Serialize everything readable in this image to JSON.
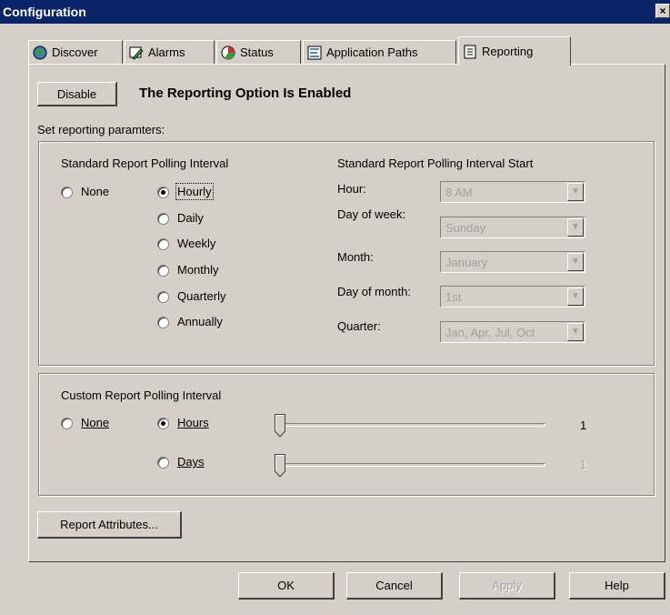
{
  "window": {
    "title": "Configuration",
    "close_glyph": "×"
  },
  "tabs": [
    {
      "label": "Discover",
      "icon": "globe-icon",
      "active": false
    },
    {
      "label": "Alarms",
      "icon": "alarm-icon",
      "active": false
    },
    {
      "label": "Status",
      "icon": "status-icon",
      "active": false
    },
    {
      "label": "Application Paths",
      "icon": "application-paths-icon",
      "active": false
    },
    {
      "label": "Reporting",
      "icon": "reporting-icon",
      "active": true
    }
  ],
  "reporting": {
    "disable_button": "Disable",
    "status_text": "The Reporting Option Is Enabled",
    "set_params_label": "Set reporting paramters:",
    "standard": {
      "title": "Standard Report Polling Interval",
      "none_label": "None",
      "options": [
        "Hourly",
        "Daily",
        "Weekly",
        "Monthly",
        "Quarterly",
        "Annually"
      ],
      "selected": "Hourly"
    },
    "start": {
      "title": "Standard Report Polling Interval Start",
      "fields": [
        {
          "label": "Hour:",
          "value": "8 AM"
        },
        {
          "label": "Day of week:",
          "value": "Sunday"
        },
        {
          "label": "Month:",
          "value": "January"
        },
        {
          "label": "Day of month:",
          "value": "1st"
        },
        {
          "label": "Quarter:",
          "value": "Jan, Apr, Jul, Oct"
        }
      ],
      "enabled": false
    },
    "custom": {
      "title": "Custom Report Polling Interval",
      "none_label": "None",
      "hours_label": "Hours",
      "days_label": "Days",
      "selected": "Hours",
      "hours_value": "1",
      "days_value": "1"
    },
    "report_attributes_button": "Report Attributes..."
  },
  "footer": {
    "ok": "OK",
    "cancel": "Cancel",
    "apply": "Apply",
    "help": "Help"
  }
}
